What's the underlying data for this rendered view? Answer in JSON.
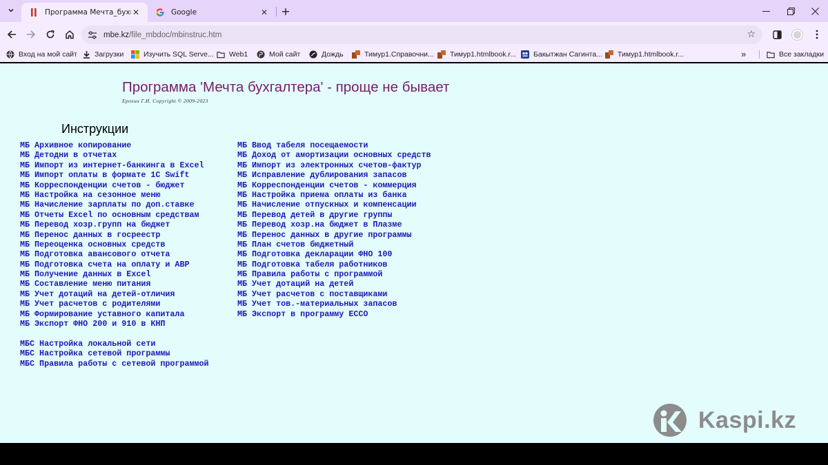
{
  "browser": {
    "tabs": [
      {
        "title": "Программа Мечта_бухгалтер",
        "icon": "pause-red-favicon",
        "active": true
      },
      {
        "title": "Google",
        "icon": "google-favicon",
        "active": false
      }
    ],
    "new_tab_label": "+",
    "url_domain": "mbe.kz",
    "url_path": "/file_mbdoc/mbinstruc.htm",
    "bookmarks": [
      {
        "label": "Вход на мой сайт",
        "icon": "globe-icon"
      },
      {
        "label": "Загрузки",
        "icon": "download-icon"
      },
      {
        "label": "Изучить SQL Serve...",
        "icon": "windows-icon"
      },
      {
        "label": "Web1",
        "icon": "folder-icon"
      },
      {
        "label": "Мой сайт",
        "icon": "globe-icon"
      },
      {
        "label": "Дождь",
        "icon": "globe-icon"
      },
      {
        "label": "Тимур1.Справочни...",
        "icon": "bookmark-brown-icon"
      },
      {
        "label": "Тимур1.htmlbook.r...",
        "icon": "bookmark-brown-icon"
      },
      {
        "label": "Бакытжан Сагинта...",
        "icon": "bookmark-blue-icon"
      },
      {
        "label": "Тимур1.htmlbook.r...",
        "icon": "bookmark-brown-icon"
      }
    ],
    "all_bookmarks_label": "Все закладки"
  },
  "page": {
    "title": "Программа 'Мечта бухгалтера' - проще не бывает",
    "copyright": "Ерохин Г.И. Copyright © 2009-2023",
    "section_title": "Инструкции",
    "left_column": [
      "МБ Архивное копирование",
      "МБ Детодни в отчетах",
      "МБ Импорт из интернет-банкинга в Excel",
      "МБ Импорт оплаты в формате 1С Swift",
      "МБ Корреспонденции счетов - бюджет",
      "МБ Настройка на сезонное меню",
      "МБ Начисление зарплаты по доп.ставке",
      "МБ Отчеты Excel по основным средствам",
      "МБ Перевод хозр.групп на бюджет",
      "МБ Перенос данных в госреестр",
      "МБ Переоценка основных средств",
      "МБ Подготовка авансового отчета",
      "МБ Подготовка счета на оплату и АВР",
      "МБ Получение данных в Excel",
      "МБ Составление меню питания",
      "МБ Учет дотаций на детей-отличия",
      "МБ Учет расчетов с родителями",
      "МБ Формирование уставного капитала",
      "МБ Экспорт ФНО 200 и 910 в КНП"
    ],
    "right_column": [
      "МБ Ввод табеля посещаемости",
      "МБ Доход от амортизации основных средств",
      "МБ Импорт из электронных счетов-фактур",
      "МБ Исправление дублирования запасов",
      "МБ Корреспонденции счетов - коммерция",
      "МБ Настройка приема оплаты из банка",
      "МБ Начисление отпускных и компенсации",
      "МБ Перевод детей в другие группы",
      "МБ Перевод хозр.на бюджет в Плазме",
      "МБ Перенос данных в другие программы",
      "МБ План счетов бюджетный",
      "МБ Подготовка декларации ФНО 100",
      "МБ Подготовка табеля работников",
      "МБ Правила работы с программой",
      "МБ Учет дотаций на детей",
      "МБ Учет расчетов с поставщиками",
      "МБ Учет тов.-материальных запасов",
      "МБ Экспорт в программу ЕССО"
    ],
    "mbs_column": [
      "МБС Настройка локальной сети",
      "МБС Настройка сетевой программы",
      "МБС Правила работы с сетевой программой"
    ]
  },
  "watermark": {
    "text": "Kaspi.kz",
    "icon": "kaspi-logo-icon"
  },
  "colors": {
    "tab_strip": "#e7d4fb",
    "toolbar": "#f5edff",
    "page_bg": "#e3fcfc",
    "title": "#7a1b6a",
    "link": "#1a1ab3"
  }
}
